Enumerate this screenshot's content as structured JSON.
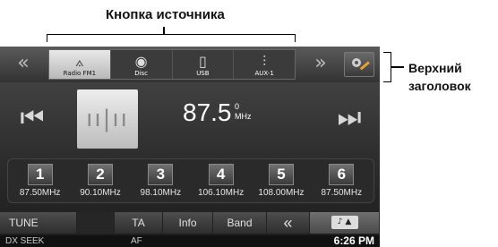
{
  "callouts": {
    "source_button": "Кнопка источника",
    "top_header_line1": "Верхний",
    "top_header_line2": "заголовок"
  },
  "topbar": {
    "left_arrow": "«",
    "right_arrow": "»",
    "sources": [
      {
        "label": "Radio FM1",
        "icon": "antenna-icon",
        "active": true
      },
      {
        "label": "Disc",
        "icon": "disc-icon",
        "active": false
      },
      {
        "label": "USB",
        "icon": "usb-icon",
        "active": false
      },
      {
        "label": "AUX-1",
        "icon": "aux-icon",
        "active": false
      }
    ],
    "setup_icon": "settings-wrench-icon"
  },
  "tuner": {
    "frequency": "87.5",
    "superscript": "0",
    "unit": "MHz",
    "prev_icon": "skip-back-icon",
    "next_icon": "skip-forward-icon"
  },
  "presets": [
    {
      "num": "1",
      "freq": "87.50MHz"
    },
    {
      "num": "2",
      "freq": "90.10MHz"
    },
    {
      "num": "3",
      "freq": "98.10MHz"
    },
    {
      "num": "4",
      "freq": "106.10MHz"
    },
    {
      "num": "5",
      "freq": "108.00MHz"
    },
    {
      "num": "6",
      "freq": "87.50MHz"
    }
  ],
  "bottom": {
    "tune": "TUNE",
    "ta": "TA",
    "info": "Info",
    "band": "Band",
    "back": "«"
  },
  "status": {
    "dx_seek": "DX SEEK",
    "af": "AF",
    "time": "6:26 PM"
  }
}
